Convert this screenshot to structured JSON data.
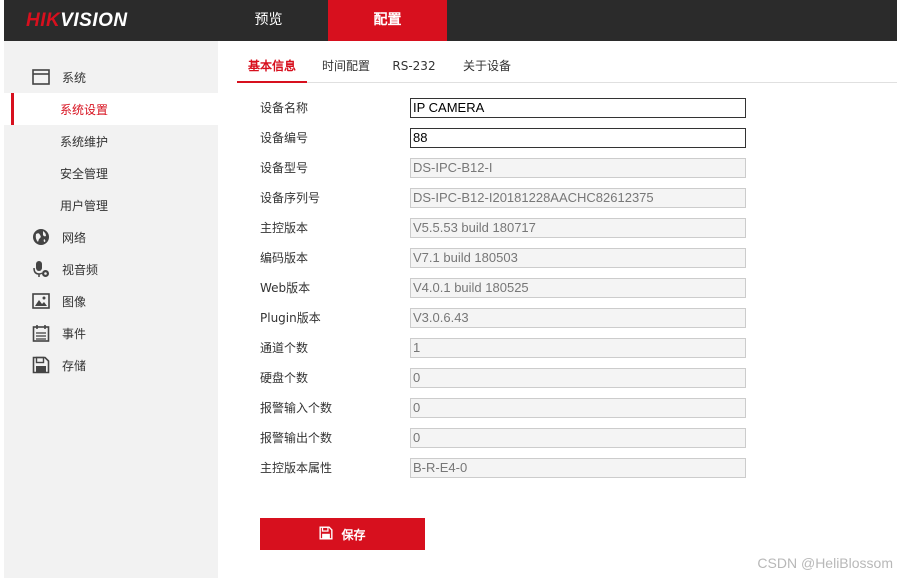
{
  "brand": {
    "hik": "HIK",
    "vision": "VISION"
  },
  "topnav": [
    {
      "label": "预览",
      "active": false
    },
    {
      "label": "配置",
      "active": true
    }
  ],
  "sidebar": {
    "items": [
      {
        "label": "系统",
        "icon": "system-icon"
      },
      {
        "label": "系统设置",
        "active": true
      },
      {
        "label": "系统维护"
      },
      {
        "label": "安全管理"
      },
      {
        "label": "用户管理"
      },
      {
        "label": "网络",
        "icon": "network-globe-icon"
      },
      {
        "label": "视音频",
        "icon": "microphone-icon"
      },
      {
        "label": "图像",
        "icon": "image-icon"
      },
      {
        "label": "事件",
        "icon": "calendar-icon"
      },
      {
        "label": "存储",
        "icon": "save-disk-icon"
      }
    ]
  },
  "subtabs": [
    {
      "label": "基本信息",
      "active": true
    },
    {
      "label": "时间配置"
    },
    {
      "label": "RS-232"
    },
    {
      "label": "关于设备"
    }
  ],
  "form": {
    "fields": [
      {
        "label": "设备名称",
        "value": "IP CAMERA",
        "editable": true
      },
      {
        "label": "设备编号",
        "value": "88",
        "editable": true
      },
      {
        "label": "设备型号",
        "value": "DS-IPC-B12-I"
      },
      {
        "label": "设备序列号",
        "value": "DS-IPC-B12-I20181228AACHC82612375"
      },
      {
        "label": "主控版本",
        "value": "V5.5.53 build 180717"
      },
      {
        "label": "编码版本",
        "value": "V7.1 build 180503"
      },
      {
        "label": "Web版本",
        "value": "V4.0.1 build 180525"
      },
      {
        "label": "Plugin版本",
        "value": "V3.0.6.43"
      },
      {
        "label": "通道个数",
        "value": "1"
      },
      {
        "label": "硬盘个数",
        "value": "0"
      },
      {
        "label": "报警输入个数",
        "value": "0"
      },
      {
        "label": "报警输出个数",
        "value": "0"
      },
      {
        "label": "主控版本属性",
        "value": "B-R-E4-0"
      }
    ]
  },
  "actions": {
    "save_label": "保存"
  },
  "watermark": "CSDN @HeliBlossom",
  "colors": {
    "accent": "#d7101e",
    "topbar": "#2b2b2b",
    "sidebar": "#f2f2f2"
  }
}
